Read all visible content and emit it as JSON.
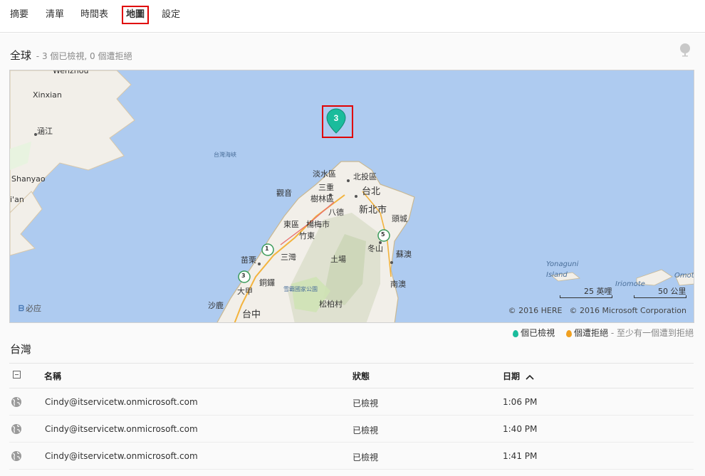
{
  "nav": {
    "tabs": [
      {
        "label": "摘要"
      },
      {
        "label": "清單"
      },
      {
        "label": "時間表"
      },
      {
        "label": "地圖",
        "active": true
      },
      {
        "label": "設定"
      }
    ]
  },
  "world": {
    "title": "全球",
    "summary": "- 3 個已檢視, 0 個遭拒絕"
  },
  "map": {
    "labels": {
      "wenzhou": "Wenzhou",
      "xinxian": "Xinxian",
      "hanjiang": "涵江",
      "shanyao": "Shanyao",
      "xian": "i'an",
      "strait": "台灣海峽",
      "tamsui": "淡水區",
      "beitou": "北投區",
      "sanchong": "三重",
      "taipei": "台北",
      "guanyin": "觀音",
      "shulin": "樹林區",
      "newtaipei": "新北市",
      "bade": "八德",
      "dongqu": "東區",
      "yangmei": "楊梅市",
      "zhudong": "竹東",
      "toucheng": "頭城",
      "miaoli": "苗栗",
      "sanwan": "三灣",
      "dongshan": "冬山",
      "suao": "蘇澳",
      "tuchang": "土場",
      "tongluo": "銅鑼",
      "dajia": "大甲",
      "shaluo": "沙鹿",
      "taichung": "台中",
      "shei": "雪霸國家公園",
      "songbo": "松柏村",
      "nanao": "南澳",
      "yonaguni": "Yonaguni",
      "island": "Island",
      "iriomote": "Iriomote",
      "omoto": "Omot",
      "route1": "1",
      "route3": "3",
      "route5": "5"
    },
    "bing_label": "必应",
    "scale_mi": "25 英哩",
    "scale_km": "50 公里",
    "copyright_here": "© 2016 HERE",
    "copyright_ms": "© 2016 Microsoft Corporation",
    "cluster_count": "3",
    "water_color": "#aecbf0",
    "land_color": "#f2efe9",
    "pin_color": "#1abc9c"
  },
  "legend": {
    "viewed": "個已檢視",
    "rejected": "個遭拒絕",
    "hint": "- 至少有一個遭到拒絕",
    "viewed_color": "#1abc9c",
    "rejected_color": "#f0a020"
  },
  "region": {
    "title": "台灣"
  },
  "table": {
    "headers": {
      "name": "名稱",
      "status": "狀態",
      "date": "日期"
    },
    "sort_icon": "chevron-up-icon",
    "rows": [
      {
        "name": "Cindy@itservicetw.onmicrosoft.com",
        "status": "已檢視",
        "date": "1:06 PM"
      },
      {
        "name": "Cindy@itservicetw.onmicrosoft.com",
        "status": "已檢視",
        "date": "1:40 PM"
      },
      {
        "name": "Cindy@itservicetw.onmicrosoft.com",
        "status": "已檢視",
        "date": "1:41 PM"
      }
    ]
  }
}
